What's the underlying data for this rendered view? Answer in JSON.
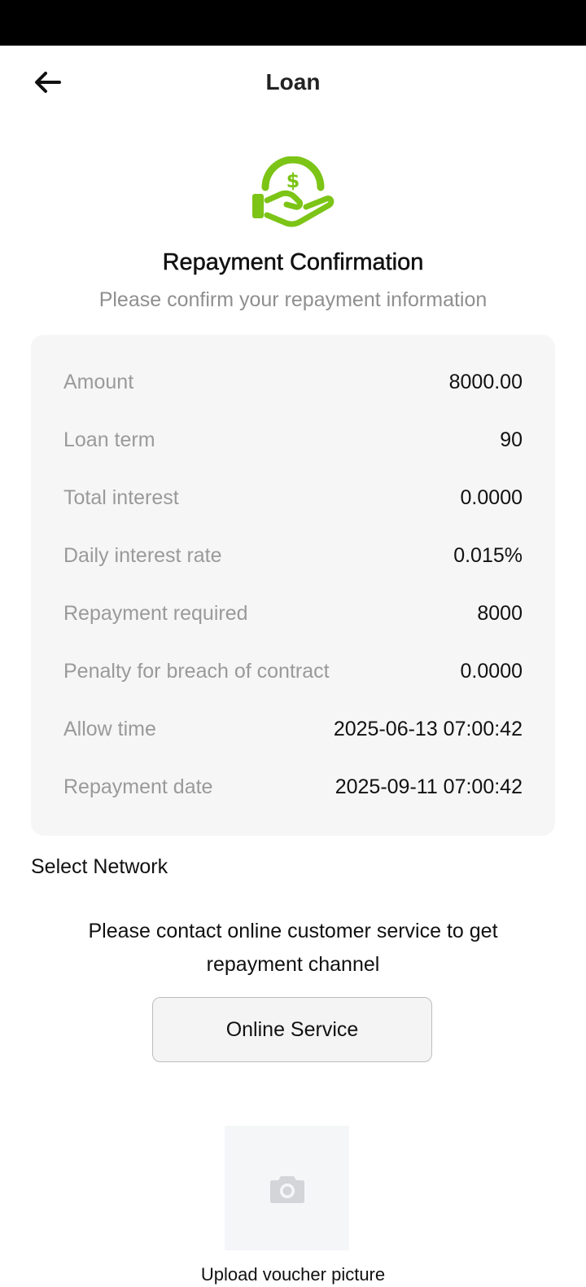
{
  "header": {
    "title": "Loan",
    "back_icon": "arrow-left-icon"
  },
  "hero": {
    "icon": "hand-dollar-icon",
    "icon_color": "#7cc416",
    "title": "Repayment Confirmation",
    "subtitle": "Please confirm your repayment information"
  },
  "details": [
    {
      "label": "Amount",
      "value": "8000.00"
    },
    {
      "label": "Loan term",
      "value": "90"
    },
    {
      "label": "Total interest",
      "value": "0.0000"
    },
    {
      "label": "Daily interest rate",
      "value": "0.015%"
    },
    {
      "label": "Repayment required",
      "value": "8000"
    },
    {
      "label": "Penalty for breach of contract",
      "value": "0.0000"
    },
    {
      "label": "Allow time",
      "value": "2025-06-13 07:00:42"
    },
    {
      "label": "Repayment date",
      "value": "2025-09-11 07:00:42"
    }
  ],
  "network": {
    "label": "Select Network",
    "notice": "Please contact online customer service to get repayment channel",
    "button_label": "Online Service"
  },
  "upload": {
    "icon": "camera-icon",
    "caption": "Upload voucher picture"
  }
}
